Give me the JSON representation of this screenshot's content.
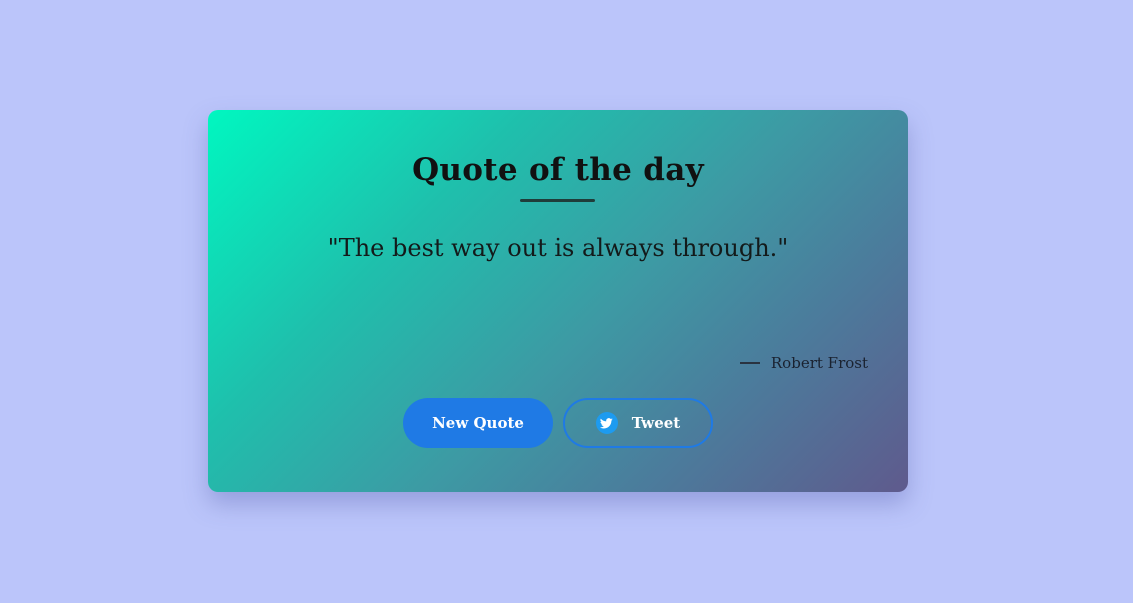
{
  "card": {
    "title": "Quote of the day",
    "quote": "\"The best way out is always through.\"",
    "author": "Robert Frost"
  },
  "buttons": {
    "new_quote_label": "New Quote",
    "tweet_label": "Tweet",
    "tweet_icon": "twitter-bird-icon"
  },
  "colors": {
    "page_background": "#bbc5fa",
    "gradient_start": "#00f7c0",
    "gradient_end": "#5f5a8d",
    "button_blue": "#1f7ae5",
    "twitter_blue": "#1d9bf0"
  }
}
